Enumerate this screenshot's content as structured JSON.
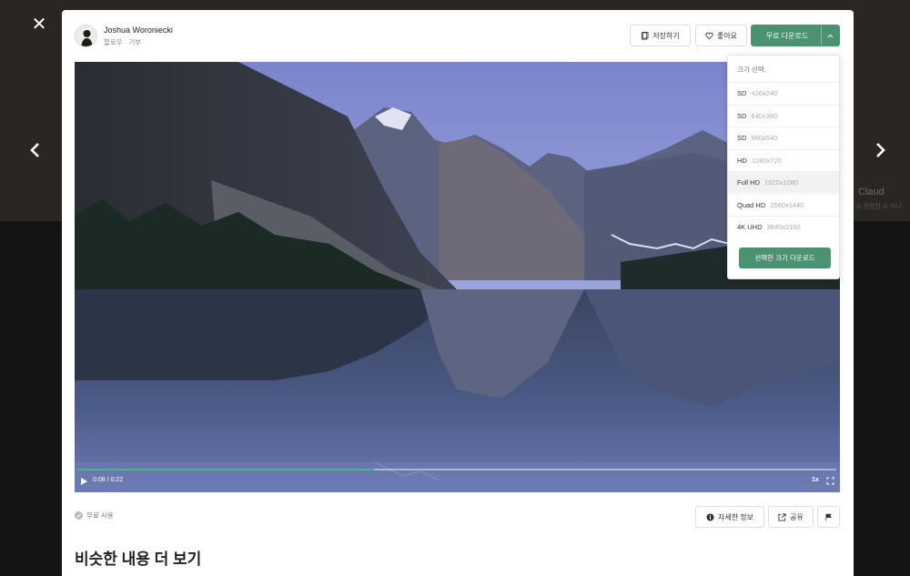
{
  "author": {
    "name": "Joshua Woroniecki",
    "subtitle": "팔로우 · 기부"
  },
  "header": {
    "save_label": "저장하기",
    "like_label": "좋아요",
    "download_label": "무료 다운로드"
  },
  "size_menu": {
    "title": "크기 선택:",
    "options": [
      {
        "quality": "SD",
        "resolution": "426x240"
      },
      {
        "quality": "SD",
        "resolution": "640x360"
      },
      {
        "quality": "SD",
        "resolution": "960x540"
      },
      {
        "quality": "HD",
        "resolution": "1280x720"
      },
      {
        "quality": "Full HD",
        "resolution": "1920x1080"
      },
      {
        "quality": "Quad HD",
        "resolution": "2560x1440"
      },
      {
        "quality": "4K UHD",
        "resolution": "3840x2160"
      }
    ],
    "selected_index": 4,
    "download_selected_label": "선택한 크기 다운로드"
  },
  "video": {
    "time": "0:08 / 0:22",
    "speed": "1x",
    "progress": 0.39
  },
  "footer": {
    "license_label": "무료 사용",
    "info_label": "자세한 정보",
    "share_label": "공유"
  },
  "similar_title": "비슷한 내용 더 보기",
  "backdrop": {
    "text": "Claud",
    "text2": "과 정장한 수 아니"
  },
  "colors": {
    "accent": "#4a9270",
    "progress": "#4fb48a"
  }
}
